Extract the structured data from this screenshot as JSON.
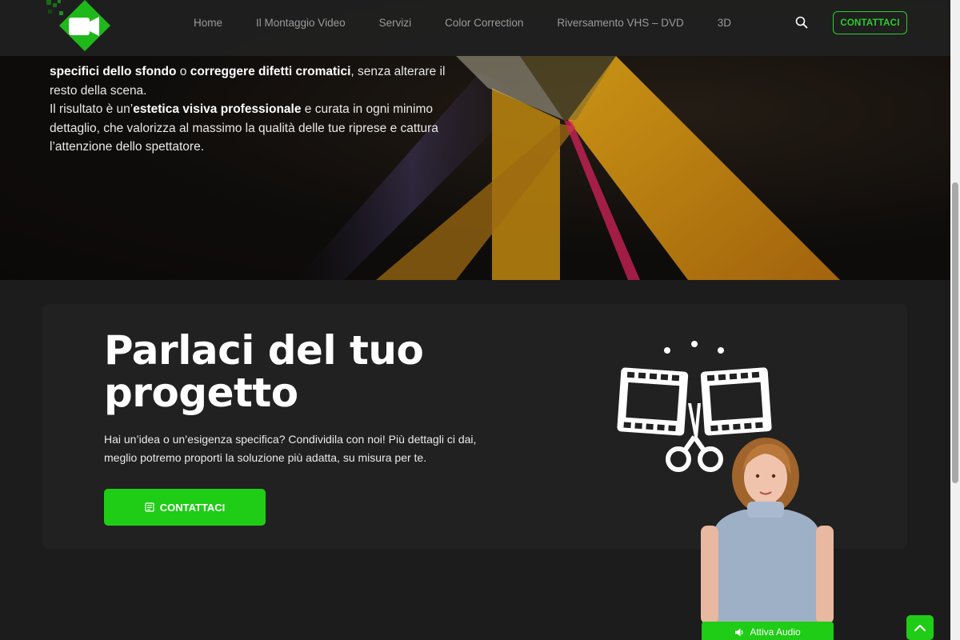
{
  "header": {
    "logo_icon": "video-camera-logo",
    "nav": [
      {
        "label": "Home"
      },
      {
        "label": "Il Montaggio Video"
      },
      {
        "label": "Servizi"
      },
      {
        "label": "Color Correction"
      },
      {
        "label": "Riversamento VHS – DVD"
      },
      {
        "label": "3D"
      }
    ],
    "search_icon": "search-icon",
    "cta_label": "CONTATTACI"
  },
  "hero": {
    "line1_bold_a": "specifici dello sfondo",
    "line1_mid": " o ",
    "line1_bold_b": "correggere difetti cromatici",
    "line1_end": ", senza alterare il",
    "line2": "resto della scena.",
    "line3_start": "Il risultato è un’",
    "line3_bold": "estetica visiva professionale",
    "line3_end": " e curata in ogni minimo",
    "line4": "dettaglio, che valorizza al massimo la qualità delle tue riprese e cattura",
    "line5": "l’attenzione dello spettatore."
  },
  "cta": {
    "title": "Parlaci del tuo progetto",
    "text": "Hai un’idea o un’esigenza specifica? Condividila con noi! Più dettagli ci dai, meglio potremo proporti la soluzione più adatta, su misura per te.",
    "button_label": "CONTATTACI",
    "button_icon": "form-icon",
    "illustration_icon": "film-cut-scissors-icon"
  },
  "presenter": {
    "audio_label": "Attiva Audio",
    "audio_icon": "speaker-icon"
  },
  "scroll_top_icon": "chevron-up-icon",
  "colors": {
    "accent": "#1fcc16",
    "background": "#1c1c1c",
    "card": "#212121"
  }
}
